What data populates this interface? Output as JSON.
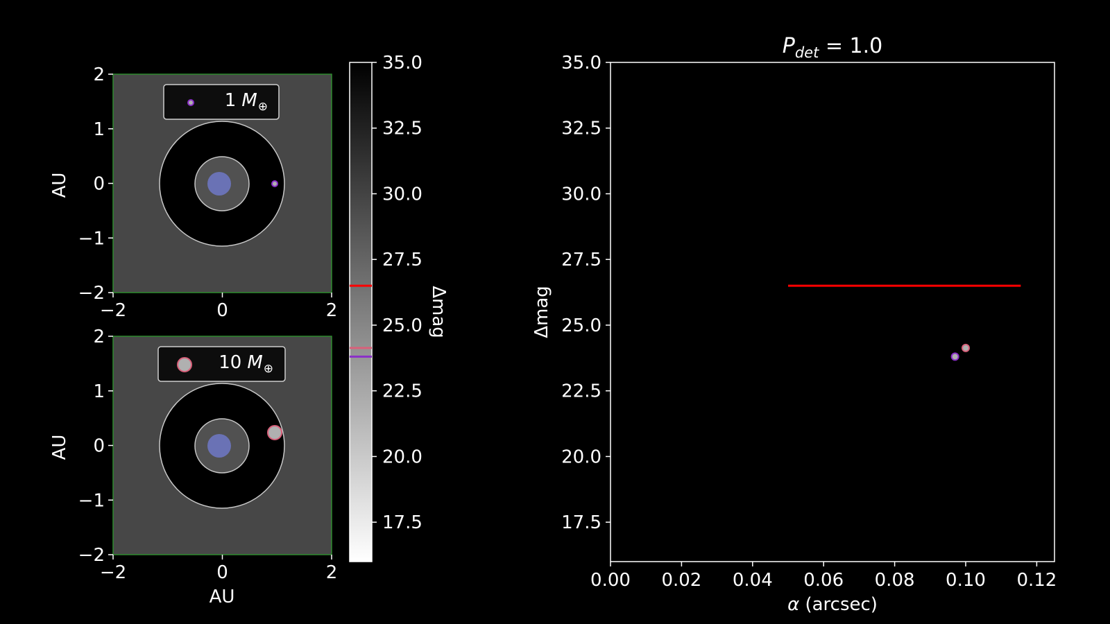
{
  "chart_data": [
    {
      "type": "scatter",
      "panel": "orbit_top",
      "xlabel": "",
      "ylabel": "AU",
      "xlim": [
        -2,
        2
      ],
      "ylim": [
        -2,
        2
      ],
      "x_ticks": [
        "−2",
        "0",
        "2"
      ],
      "y_ticks": [
        "−2",
        "−1",
        "0",
        "1",
        "2"
      ],
      "background_value": 26.5,
      "star": {
        "x": -0.05,
        "y": 0.0
      },
      "inner_orbit_au": 0.5,
      "outer_orbit_au": 1.15,
      "planet": {
        "x": 0.98,
        "y": 0.0,
        "color": "#8b2fc9",
        "mass_label": "1"
      },
      "legend": {
        "label_number": "1",
        "label_symbol": "M",
        "label_sub": "⊕",
        "marker_color": "#8b2fc9"
      }
    },
    {
      "type": "scatter",
      "panel": "orbit_bottom",
      "xlabel": "AU",
      "ylabel": "AU",
      "xlim": [
        -2,
        2
      ],
      "ylim": [
        -2,
        2
      ],
      "x_ticks": [
        "−2",
        "0",
        "2"
      ],
      "y_ticks": [
        "−2",
        "−1",
        "0",
        "1",
        "2"
      ],
      "background_value": 26.5,
      "star": {
        "x": -0.05,
        "y": 0.0
      },
      "inner_orbit_au": 0.5,
      "outer_orbit_au": 1.15,
      "planet": {
        "x": 0.96,
        "y": 0.25,
        "color": "#d9607a",
        "mass_label": "10"
      },
      "legend": {
        "label_number": "10",
        "label_symbol": "M",
        "label_sub": "⊕",
        "marker_color": "#d9607a"
      }
    },
    {
      "type": "colorbar",
      "panel": "colorbar",
      "label": "Δmag",
      "range": [
        16.0,
        35.0
      ],
      "ticks": [
        "17.5",
        "20.0",
        "22.5",
        "25.0",
        "27.5",
        "30.0",
        "32.5",
        "35.0"
      ],
      "markers": [
        {
          "value": 26.5,
          "color": "#ff0000"
        },
        {
          "value": 24.13,
          "color": "#d9607a"
        },
        {
          "value": 23.8,
          "color": "#8b2fc9"
        }
      ]
    },
    {
      "type": "scatter",
      "panel": "main",
      "title_main": "P",
      "title_sub": "det",
      "title_rest": " = 1.0",
      "xlabel_symbol": "α",
      "xlabel_rest": " (arcsec)",
      "ylabel": "Δmag",
      "xlim": [
        0.0,
        0.125
      ],
      "ylim": [
        16.0,
        35.0
      ],
      "x_ticks": [
        "0.00",
        "0.02",
        "0.04",
        "0.06",
        "0.08",
        "0.10",
        "0.12"
      ],
      "y_ticks": [
        "17.5",
        "20.0",
        "22.5",
        "25.0",
        "27.5",
        "30.0",
        "32.5",
        "35.0"
      ],
      "contrast_line": {
        "x": [
          0.05,
          0.1155
        ],
        "y": 26.5,
        "color": "#ff0000"
      },
      "points": [
        {
          "x": 0.097,
          "y": 23.8,
          "color": "#8b2fc9"
        },
        {
          "x": 0.1,
          "y": 24.13,
          "color": "#d9607a"
        }
      ]
    }
  ],
  "colors": {
    "background": "#000000",
    "panel_fill": "#474747",
    "panel_border": "#2e8b2e",
    "star": "#6a72b5",
    "orbit": "#c8c8c8",
    "inner_disk": "#515151",
    "contrast": "#ff0000",
    "planet_1": "#8b2fc9",
    "planet_10": "#d9607a"
  }
}
